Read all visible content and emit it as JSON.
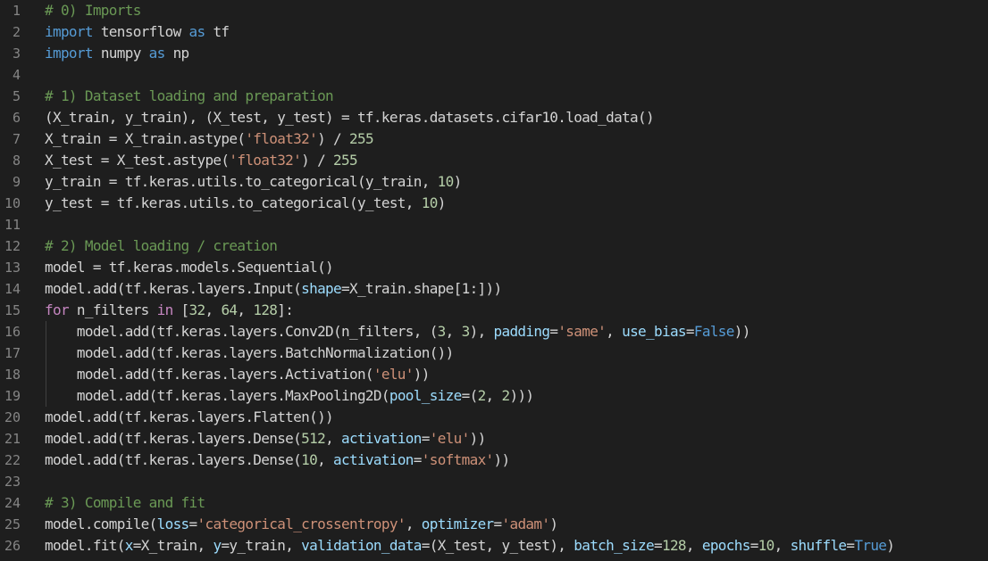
{
  "theme": {
    "background": "#1e1e1e",
    "line_number_color": "#858585",
    "token_colors": {
      "plain": "#d4d4d4",
      "keyword": "#569cd6",
      "control": "#c586c0",
      "string": "#ce9178",
      "number": "#b5cea8",
      "comment": "#6a9955",
      "param": "#9cdcfe"
    }
  },
  "lines": [
    {
      "n": "1",
      "tokens": [
        {
          "t": "cmt",
          "v": "# 0) Imports"
        }
      ]
    },
    {
      "n": "2",
      "tokens": [
        {
          "t": "kw",
          "v": "import"
        },
        {
          "t": "plain",
          "v": " tensorflow "
        },
        {
          "t": "kw",
          "v": "as"
        },
        {
          "t": "plain",
          "v": " tf"
        }
      ]
    },
    {
      "n": "3",
      "tokens": [
        {
          "t": "kw",
          "v": "import"
        },
        {
          "t": "plain",
          "v": " numpy "
        },
        {
          "t": "kw",
          "v": "as"
        },
        {
          "t": "plain",
          "v": " np"
        }
      ]
    },
    {
      "n": "4",
      "tokens": []
    },
    {
      "n": "5",
      "tokens": [
        {
          "t": "cmt",
          "v": "# 1) Dataset loading and preparation"
        }
      ]
    },
    {
      "n": "6",
      "tokens": [
        {
          "t": "plain",
          "v": "(X_train, y_train), (X_test, y_test) = tf.keras.datasets.cifar10.load_data()"
        }
      ]
    },
    {
      "n": "7",
      "tokens": [
        {
          "t": "plain",
          "v": "X_train = X_train.astype("
        },
        {
          "t": "str",
          "v": "'float32'"
        },
        {
          "t": "plain",
          "v": ") / "
        },
        {
          "t": "num",
          "v": "255"
        }
      ]
    },
    {
      "n": "8",
      "tokens": [
        {
          "t": "plain",
          "v": "X_test = X_test.astype("
        },
        {
          "t": "str",
          "v": "'float32'"
        },
        {
          "t": "plain",
          "v": ") / "
        },
        {
          "t": "num",
          "v": "255"
        }
      ]
    },
    {
      "n": "9",
      "tokens": [
        {
          "t": "plain",
          "v": "y_train = tf.keras.utils.to_categorical(y_train, "
        },
        {
          "t": "num",
          "v": "10"
        },
        {
          "t": "plain",
          "v": ")"
        }
      ]
    },
    {
      "n": "10",
      "tokens": [
        {
          "t": "plain",
          "v": "y_test = tf.keras.utils.to_categorical(y_test, "
        },
        {
          "t": "num",
          "v": "10"
        },
        {
          "t": "plain",
          "v": ")"
        }
      ]
    },
    {
      "n": "11",
      "tokens": []
    },
    {
      "n": "12",
      "tokens": [
        {
          "t": "cmt",
          "v": "# 2) Model loading / creation"
        }
      ]
    },
    {
      "n": "13",
      "tokens": [
        {
          "t": "plain",
          "v": "model = tf.keras.models.Sequential()"
        }
      ]
    },
    {
      "n": "14",
      "tokens": [
        {
          "t": "plain",
          "v": "model.add(tf.keras.layers.Input("
        },
        {
          "t": "param",
          "v": "shape"
        },
        {
          "t": "plain",
          "v": "=X_train.shape[1:]))"
        }
      ]
    },
    {
      "n": "15",
      "tokens": [
        {
          "t": "ctrl",
          "v": "for"
        },
        {
          "t": "plain",
          "v": " n_filters "
        },
        {
          "t": "ctrl",
          "v": "in"
        },
        {
          "t": "plain",
          "v": " ["
        },
        {
          "t": "num",
          "v": "32"
        },
        {
          "t": "plain",
          "v": ", "
        },
        {
          "t": "num",
          "v": "64"
        },
        {
          "t": "plain",
          "v": ", "
        },
        {
          "t": "num",
          "v": "128"
        },
        {
          "t": "plain",
          "v": "]:"
        }
      ]
    },
    {
      "n": "16",
      "indent": true,
      "tokens": [
        {
          "t": "plain",
          "v": "    model.add(tf.keras.layers.Conv2D(n_filters, ("
        },
        {
          "t": "num",
          "v": "3"
        },
        {
          "t": "plain",
          "v": ", "
        },
        {
          "t": "num",
          "v": "3"
        },
        {
          "t": "plain",
          "v": "), "
        },
        {
          "t": "param",
          "v": "padding"
        },
        {
          "t": "plain",
          "v": "="
        },
        {
          "t": "str",
          "v": "'same'"
        },
        {
          "t": "plain",
          "v": ", "
        },
        {
          "t": "param",
          "v": "use_bias"
        },
        {
          "t": "plain",
          "v": "="
        },
        {
          "t": "kw",
          "v": "False"
        },
        {
          "t": "plain",
          "v": "))"
        }
      ]
    },
    {
      "n": "17",
      "indent": true,
      "tokens": [
        {
          "t": "plain",
          "v": "    model.add(tf.keras.layers.BatchNormalization())"
        }
      ]
    },
    {
      "n": "18",
      "indent": true,
      "tokens": [
        {
          "t": "plain",
          "v": "    model.add(tf.keras.layers.Activation("
        },
        {
          "t": "str",
          "v": "'elu'"
        },
        {
          "t": "plain",
          "v": "))"
        }
      ]
    },
    {
      "n": "19",
      "indent": true,
      "tokens": [
        {
          "t": "plain",
          "v": "    model.add(tf.keras.layers.MaxPooling2D("
        },
        {
          "t": "param",
          "v": "pool_size"
        },
        {
          "t": "plain",
          "v": "=("
        },
        {
          "t": "num",
          "v": "2"
        },
        {
          "t": "plain",
          "v": ", "
        },
        {
          "t": "num",
          "v": "2"
        },
        {
          "t": "plain",
          "v": ")))"
        }
      ]
    },
    {
      "n": "20",
      "tokens": [
        {
          "t": "plain",
          "v": "model.add(tf.keras.layers.Flatten())"
        }
      ]
    },
    {
      "n": "21",
      "tokens": [
        {
          "t": "plain",
          "v": "model.add(tf.keras.layers.Dense("
        },
        {
          "t": "num",
          "v": "512"
        },
        {
          "t": "plain",
          "v": ", "
        },
        {
          "t": "param",
          "v": "activation"
        },
        {
          "t": "plain",
          "v": "="
        },
        {
          "t": "str",
          "v": "'elu'"
        },
        {
          "t": "plain",
          "v": "))"
        }
      ]
    },
    {
      "n": "22",
      "tokens": [
        {
          "t": "plain",
          "v": "model.add(tf.keras.layers.Dense("
        },
        {
          "t": "num",
          "v": "10"
        },
        {
          "t": "plain",
          "v": ", "
        },
        {
          "t": "param",
          "v": "activation"
        },
        {
          "t": "plain",
          "v": "="
        },
        {
          "t": "str",
          "v": "'softmax'"
        },
        {
          "t": "plain",
          "v": "))"
        }
      ]
    },
    {
      "n": "23",
      "tokens": []
    },
    {
      "n": "24",
      "tokens": [
        {
          "t": "cmt",
          "v": "# 3) Compile and fit"
        }
      ]
    },
    {
      "n": "25",
      "tokens": [
        {
          "t": "plain",
          "v": "model.compile("
        },
        {
          "t": "param",
          "v": "loss"
        },
        {
          "t": "plain",
          "v": "="
        },
        {
          "t": "str",
          "v": "'categorical_crossentropy'"
        },
        {
          "t": "plain",
          "v": ", "
        },
        {
          "t": "param",
          "v": "optimizer"
        },
        {
          "t": "plain",
          "v": "="
        },
        {
          "t": "str",
          "v": "'adam'"
        },
        {
          "t": "plain",
          "v": ")"
        }
      ]
    },
    {
      "n": "26",
      "tokens": [
        {
          "t": "plain",
          "v": "model.fit("
        },
        {
          "t": "param",
          "v": "x"
        },
        {
          "t": "plain",
          "v": "=X_train, "
        },
        {
          "t": "param",
          "v": "y"
        },
        {
          "t": "plain",
          "v": "=y_train, "
        },
        {
          "t": "param",
          "v": "validation_data"
        },
        {
          "t": "plain",
          "v": "=(X_test, y_test), "
        },
        {
          "t": "param",
          "v": "batch_size"
        },
        {
          "t": "plain",
          "v": "="
        },
        {
          "t": "num",
          "v": "128"
        },
        {
          "t": "plain",
          "v": ", "
        },
        {
          "t": "param",
          "v": "epochs"
        },
        {
          "t": "plain",
          "v": "="
        },
        {
          "t": "num",
          "v": "10"
        },
        {
          "t": "plain",
          "v": ", "
        },
        {
          "t": "param",
          "v": "shuffle"
        },
        {
          "t": "plain",
          "v": "="
        },
        {
          "t": "kw",
          "v": "True"
        },
        {
          "t": "plain",
          "v": ")"
        }
      ]
    }
  ]
}
